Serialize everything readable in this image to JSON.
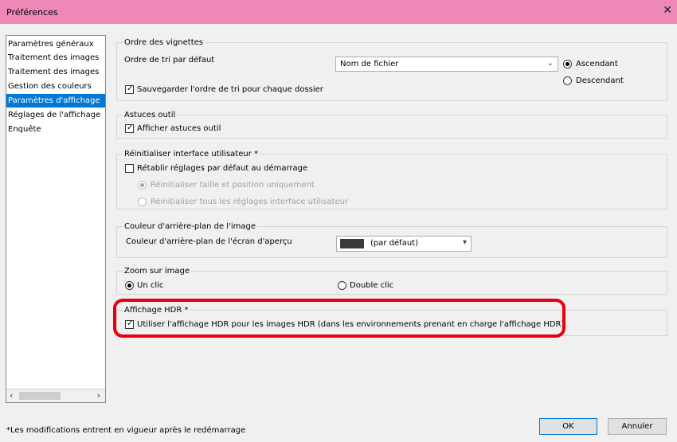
{
  "window": {
    "title": "Préférences",
    "close_glyph": "✕"
  },
  "sidebar": {
    "items": [
      {
        "label": "Paramètres généraux"
      },
      {
        "label": "Traitement des images"
      },
      {
        "label": "Traitement des images"
      },
      {
        "label": "Gestion des couleurs"
      },
      {
        "label": "Paramètres d'affichage"
      },
      {
        "label": "Réglages de l'affichage"
      },
      {
        "label": "Enquête"
      }
    ],
    "selected_index": 4,
    "scroll_left": "‹",
    "scroll_right": "›"
  },
  "thumbnail_order": {
    "legend": "Ordre des vignettes",
    "sort_label": "Ordre de tri par défaut",
    "sort_value": "Nom de fichier",
    "ascending": "Ascendant",
    "descending": "Descendant",
    "ascending_selected": true,
    "save_per_folder": "Sauvegarder l'ordre de tri pour chaque dossier",
    "save_per_folder_checked": true
  },
  "tooltips": {
    "legend": "Astuces outil",
    "show_tooltips": "Afficher astuces outil",
    "show_tooltips_checked": true
  },
  "reset_ui": {
    "legend": "Réinitialiser interface utilisateur *",
    "restore_defaults": "Rétablir réglages par défaut au démarrage",
    "restore_defaults_checked": false,
    "option_size_only": "Réinitialiser taille et position uniquement",
    "option_all": "Réinitialiser tous les réglages interface utilisateur"
  },
  "background": {
    "legend": "Couleur d'arrière-plan de l'image",
    "preview_label": "Couleur d'arrière-plan de l'écran d'aperçu",
    "value": "(par défaut)",
    "swatch_color": "#3a3a3a"
  },
  "zoom": {
    "legend": "Zoom sur image",
    "single_click": "Un clic",
    "double_click": "Double clic",
    "single_selected": true
  },
  "hdr": {
    "legend": "Affichage HDR *",
    "use_hdr": "Utiliser l'affichage HDR pour les images HDR (dans les environnements prenant en charge l'affichage HDR)",
    "use_hdr_checked": true,
    "highlight_color": "#e60012"
  },
  "footer": {
    "note": "*Les modifications entrent en vigueur après le redémarrage",
    "ok": "OK",
    "cancel": "Annuler"
  },
  "icons": {
    "check": "✓",
    "dropdown": "⌄",
    "dropdown_small": "▾"
  }
}
